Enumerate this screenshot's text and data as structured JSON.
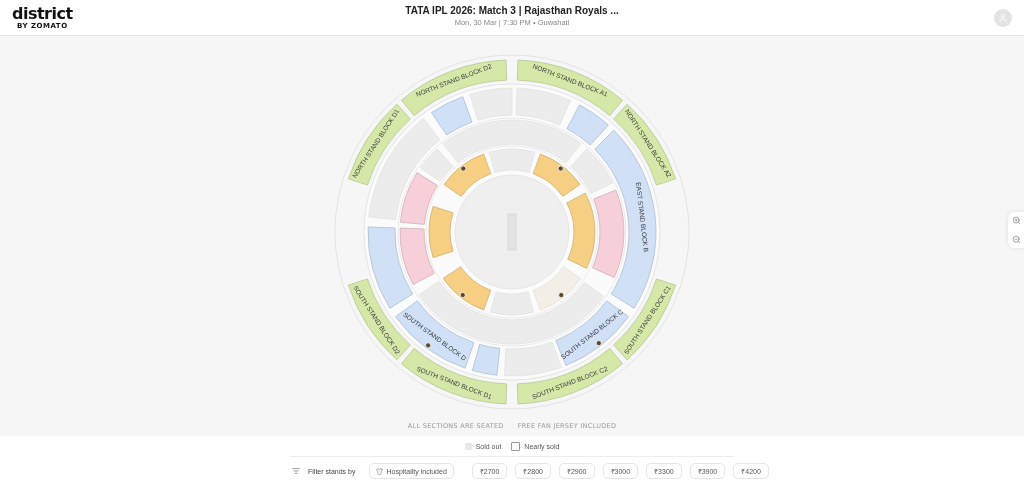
{
  "header": {
    "logo": "district",
    "logo_sub": "BY ZOMATO",
    "title": "TATA IPL 2026: Match 3 | Rajasthan Royals ...",
    "subtitle": "Mon, 30 Mar | 7:30 PM • Guwahati"
  },
  "map": {
    "sections": [
      {
        "label": "NORTH STAND BLOCK D1",
        "color": "#d6e8a8",
        "sold": false
      },
      {
        "label": "NORTH STAND BLOCK D2",
        "color": "#d6e8a8",
        "sold": false
      },
      {
        "label": "NORTH STAND BLOCK A1",
        "color": "#d6e8a8",
        "sold": false
      },
      {
        "label": "NORTH STAND BLOCK A2",
        "color": "#d6e8a8",
        "sold": false
      },
      {
        "label": "SOUTH STAND BLOCK C1",
        "color": "#d6e8a8",
        "sold": false
      },
      {
        "label": "SOUTH STAND BLOCK C2",
        "color": "#d6e8a8",
        "sold": false
      },
      {
        "label": "SOUTH STAND BLOCK D1",
        "color": "#d6e8a8",
        "sold": false
      },
      {
        "label": "SOUTH STAND BLOCK D2",
        "color": "#d6e8a8",
        "sold": false
      },
      {
        "color": "#ececec",
        "sold": true
      },
      {
        "color": "#cfe0f7",
        "sold": false
      },
      {
        "label": "EAST STAND BLOCK B",
        "color": "#cfe0f7",
        "sold": false
      },
      {
        "label": "SOUTH STAND BLOCK C",
        "color": "#cfe0f7",
        "sold": false,
        "jersey": true
      },
      {
        "color": "#ececec",
        "sold": true
      },
      {
        "color": "#cfe0f7",
        "sold": false
      },
      {
        "label": "SOUTH STAND BLOCK D",
        "color": "#cfe0f7",
        "sold": false,
        "jersey": true
      },
      {
        "color": "#cfe0f7",
        "sold": false
      },
      {
        "color": "#ececec",
        "sold": true
      },
      {
        "color": "#cfe0f7",
        "sold": false
      },
      {
        "color": "#ececec",
        "sold": true
      },
      {
        "color": "#ececec",
        "sold": true
      },
      {
        "color": "#ececec",
        "sold": true
      },
      {
        "color": "#f6cfd8",
        "sold": false
      },
      {
        "color": "#ececec",
        "sold": true
      },
      {
        "color": "#f6cfd8",
        "sold": false
      },
      {
        "color": "#f6cfd8",
        "sold": false
      },
      {
        "color": "#ececec",
        "sold": true
      },
      {
        "color": "#ececec",
        "sold": true
      },
      {
        "color": "#f7cf82",
        "sold": false,
        "jersey": true
      },
      {
        "color": "#f7cf82",
        "sold": false
      },
      {
        "color": "#f3eee6",
        "sold": true,
        "jersey": true
      },
      {
        "color": "#ececec",
        "sold": true
      },
      {
        "color": "#f7cf82",
        "sold": false,
        "jersey": true
      },
      {
        "color": "#f7cf82",
        "sold": false
      },
      {
        "color": "#f7cf82",
        "sold": false,
        "jersey": true
      }
    ],
    "notes": [
      "ALL SECTIONS ARE SEATED",
      "FREE FAN JERSEY INCLUDED"
    ]
  },
  "legend": [
    {
      "label": "Sold out",
      "kind": "sold"
    },
    {
      "label": "Nearly sold",
      "kind": "nearly"
    }
  ],
  "filters": {
    "label": "Filter stands by",
    "chips": [
      {
        "label": "Hospitality included",
        "kind": "hospitality"
      },
      {
        "label": "₹2700",
        "kind": "price"
      },
      {
        "label": "₹2800",
        "kind": "price"
      },
      {
        "label": "₹2900",
        "kind": "price"
      },
      {
        "label": "₹3000",
        "kind": "price"
      },
      {
        "label": "₹3300",
        "kind": "price"
      },
      {
        "label": "₹3900",
        "kind": "price"
      },
      {
        "label": "₹4200",
        "kind": "price"
      }
    ]
  }
}
